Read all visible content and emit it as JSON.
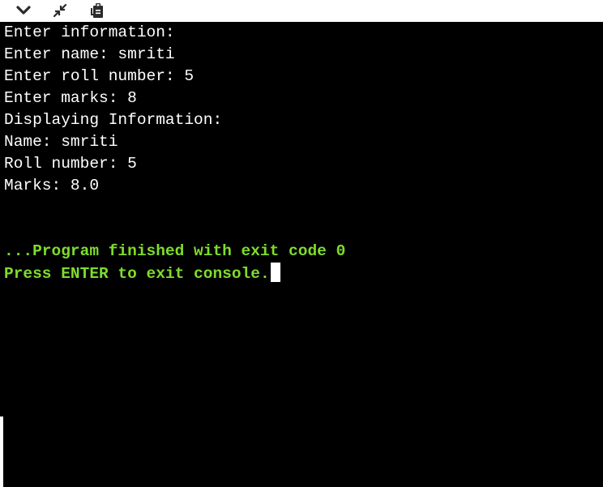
{
  "toolbar": {
    "icons": [
      "chevron-down-icon",
      "collapse-arrows-icon",
      "clipboard-icon"
    ]
  },
  "console": {
    "output_lines": [
      "Enter information:",
      "Enter name: smriti",
      "Enter roll number: 5",
      "Enter marks: 8",
      "Displaying Information:",
      "Name: smriti",
      "Roll number: 5",
      "Marks: 8.0"
    ],
    "exit_message": "...Program finished with exit code 0",
    "prompt_message": "Press ENTER to exit console."
  },
  "colors": {
    "background": "#000000",
    "output_text": "#ffffff",
    "status_text": "#7fdc2c"
  }
}
